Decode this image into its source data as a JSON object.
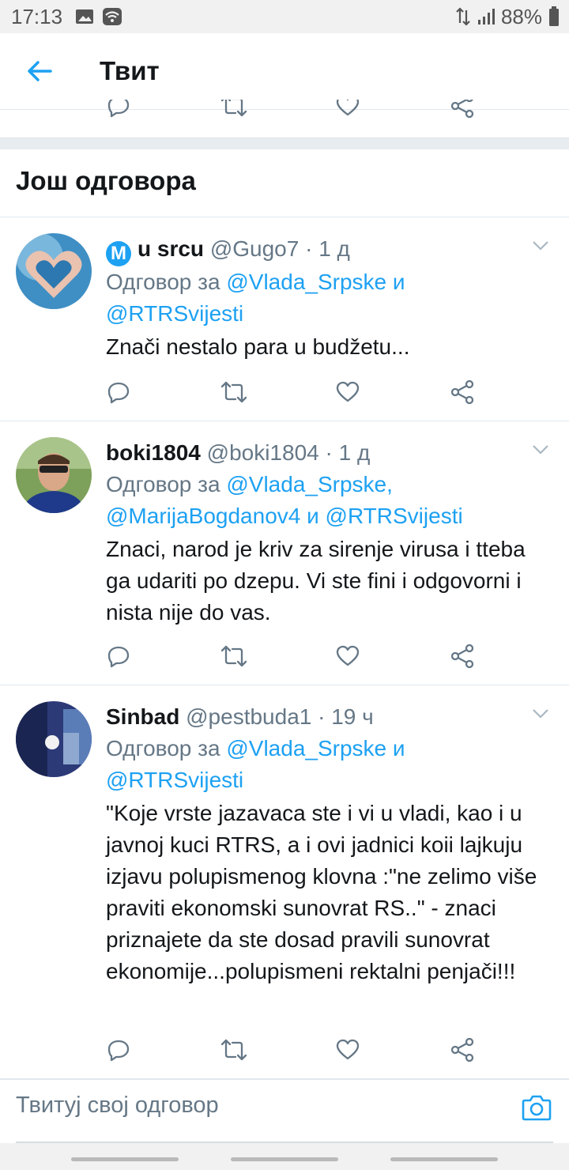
{
  "status_bar": {
    "time": "17:13",
    "battery": "88%"
  },
  "header": {
    "title": "Твит"
  },
  "section": {
    "title": "Још одговора"
  },
  "tweets": [
    {
      "display_name": "u srcu",
      "badge": "M",
      "handle": "@Gugo7",
      "separator": "·",
      "time_ago": "1 д",
      "reply_prefix": "Одговор за",
      "mention_1": "@Vlada_Srpske",
      "conj_1": "и",
      "mention_2": "@RTRSvijesti",
      "text": "Znači nestalo para u budžetu..."
    },
    {
      "display_name": "boki1804",
      "handle": "@boki1804",
      "separator": "·",
      "time_ago": "1 д",
      "reply_prefix": "Одговор за",
      "mention_1": "@Vlada_Srpske,",
      "mention_2": "@MarijaBogdanov4",
      "conj_1": "и",
      "mention_3": "@RTRSvijesti",
      "text": "Znaci, narod je kriv za sirenje virusa i tteba ga udariti po dzepu. Vi ste fini i odgovorni i nista nije do vas."
    },
    {
      "display_name": "Sinbad",
      "handle": "@pestbuda1",
      "separator": "·",
      "time_ago": "19 ч",
      "reply_prefix": "Одговор за",
      "mention_1": "@Vlada_Srpske",
      "conj_1": "и",
      "mention_2": "@RTRSvijesti",
      "text": "\"Koje vrste jazavaca ste i vi u vladi, kao i u javnoj kuci RTRS, a i ovi jadnici koii lajkuju izjavu polupismenog klovna :\"ne zelimo više praviti ekonomski sunovrat RS..\" - znaci priznajete da ste dosad pravili sunovrat ekonomije...polupismeni rektalni penjači!!!"
    }
  ],
  "composer": {
    "placeholder": "Твитуј свој одговор"
  },
  "colors": {
    "accent": "#1da1f2",
    "secondary_text": "#657786",
    "icon_gray": "#657786"
  },
  "icons": [
    "back-arrow-icon",
    "reply-icon",
    "retweet-icon",
    "like-icon",
    "share-icon",
    "chevron-down-icon",
    "camera-icon"
  ]
}
